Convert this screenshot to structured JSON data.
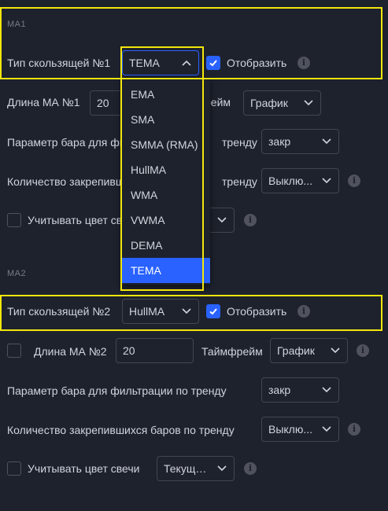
{
  "ma1": {
    "section_title": "MA1",
    "type_label": "Тип скользящей №1",
    "type_value": "TEMA",
    "display_label": "Отобразить",
    "length_label": "Длина МА №1",
    "length_value": "20",
    "timeframe_label_partial": "рейм",
    "timeframe_value": "График",
    "bar_param_label_a": "Параметр бара для фи",
    "bar_param_label_b": "тренду",
    "bar_param_value": "закр",
    "count_label_a": "Количество закрепивш",
    "count_label_b": "тренду",
    "count_value": "Выклю...",
    "candle_label": "Учитывать цвет св"
  },
  "dropdown": {
    "options": [
      "EMA",
      "SMA",
      "SMMA (RMA)",
      "HullMA",
      "WMA",
      "VWMA",
      "DEMA",
      "TEMA"
    ],
    "selected": "TEMA"
  },
  "ma2": {
    "section_title": "MA2",
    "type_label": "Тип скользящей №2",
    "type_value": "HullMA",
    "display_label": "Отобразить",
    "length_label": "Длина МА №2",
    "length_value": "20",
    "timeframe_label": "Таймфрейм",
    "timeframe_value": "График",
    "bar_param_label": "Параметр бара для фильтрации по тренду",
    "bar_param_value": "закр",
    "count_label": "Количество закрепившихся баров по тренду",
    "count_value": "Выклю...",
    "candle_label": "Учитывать цвет свечи",
    "candle_value": "Текущи..."
  },
  "icons": {
    "info": "i",
    "chevron_down": "chevron-down-icon",
    "chevron_up": "chevron-up-icon",
    "check": "check-icon"
  },
  "colors": {
    "background": "#1e222d",
    "accent": "#2962ff",
    "highlight": "#f2e60b",
    "text": "#d1d4dc",
    "muted": "#787b86"
  }
}
